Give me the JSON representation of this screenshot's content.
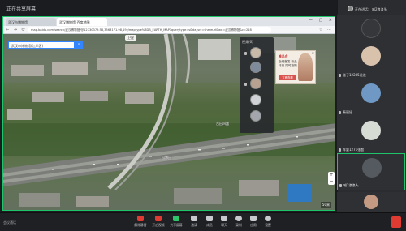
{
  "share": {
    "title": "正在共享屏幕"
  },
  "browser": {
    "tabs": [
      {
        "label": "武汉市博物馆"
      },
      {
        "label": "武汉博物馆-百度地图"
      }
    ],
    "url": "map.baidu.com/search/武汉博物馆/@12730379.58,3563171.98,19z/maptype%3DB_EARTH_MAP?querytype=s&da_src=shareurl&wd=武汉博物馆&c=218"
  },
  "map": {
    "search_value": "武汉市博物馆(江岸区)",
    "search_button_icon": "search-icon",
    "badge": "卫星",
    "labels": [
      "古田四路",
      "园博园"
    ],
    "scale": "50米",
    "zoom_in": "+",
    "zoom_out": "−"
  },
  "video_strip": {
    "title": "视频(6)"
  },
  "ad": {
    "brand": "唯品会",
    "text": "全网首发 新品特惠 限时抢购",
    "button": "立即查看",
    "close": "×"
  },
  "panel": {
    "me_label": "正在讲话:",
    "me_name": "喵2浪浪头",
    "participants": [
      {
        "name": "华藏庄园生活家",
        "active": false
      },
      {
        "name": "张子12235爸爸",
        "active": false
      },
      {
        "name": "秦丽妞",
        "active": false
      },
      {
        "name": "车婆1271张超",
        "active": false
      },
      {
        "name": "喵2浪浪头",
        "active": true
      },
      {
        "name": "",
        "active": false
      }
    ]
  },
  "toolbar": {
    "left_text": "会议通话",
    "items": [
      {
        "label": "解除静音",
        "icon": "microphone-icon",
        "style": "red"
      },
      {
        "label": "开启视频",
        "icon": "camera-icon",
        "style": "red"
      },
      {
        "label": "共享屏幕",
        "icon": "share-screen-icon",
        "style": "green"
      },
      {
        "label": "邀请",
        "icon": "invite-icon",
        "style": ""
      },
      {
        "label": "成员",
        "icon": "members-icon",
        "style": ""
      },
      {
        "label": "聊天",
        "icon": "chat-icon",
        "style": ""
      },
      {
        "label": "录制",
        "icon": "record-icon",
        "style": ""
      },
      {
        "label": "应用",
        "icon": "apps-icon",
        "style": ""
      },
      {
        "label": "设置",
        "icon": "settings-icon",
        "style": ""
      }
    ],
    "end_icon": "end-call-icon",
    "colors": {
      "danger": "#e03b32",
      "active": "#2ec46a"
    }
  }
}
